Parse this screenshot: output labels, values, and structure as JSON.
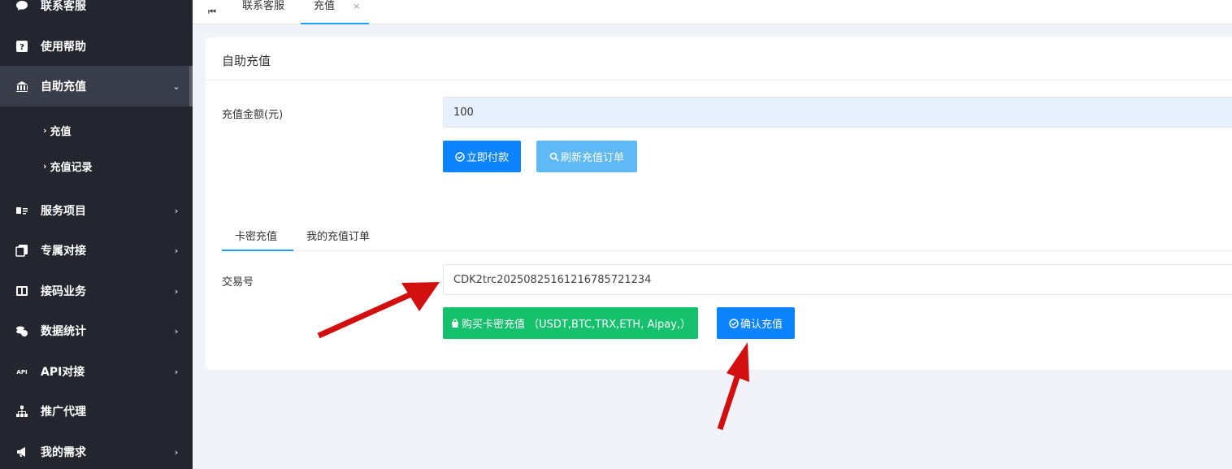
{
  "sidebar": {
    "items": [
      {
        "label": "联系客服",
        "icon": "chat-icon"
      },
      {
        "label": "使用帮助",
        "icon": "help-icon"
      },
      {
        "label": "自助充值",
        "icon": "bank-icon",
        "expanded": true
      },
      {
        "label": "服务项目",
        "icon": "card-icon"
      },
      {
        "label": "专属对接",
        "icon": "docs-icon"
      },
      {
        "label": "接码业务",
        "icon": "sim-icon"
      },
      {
        "label": "数据统计",
        "icon": "coins-icon"
      },
      {
        "label": "API对接",
        "icon": "api-icon"
      },
      {
        "label": "推广代理",
        "icon": "sitemap-icon"
      },
      {
        "label": "我的需求",
        "icon": "megaphone-icon"
      }
    ],
    "sub_items": [
      {
        "label": "充值"
      },
      {
        "label": "充值记录"
      }
    ]
  },
  "tabs": {
    "items": [
      {
        "label": "联系客服"
      },
      {
        "label": "充值",
        "active": true
      }
    ],
    "close_glyph": "×",
    "home_glyph": "⏮"
  },
  "card": {
    "title": "自助充值",
    "amount_label": "充值金额(元)",
    "amount_value": "100",
    "pay_button": "立即付款",
    "refresh_button": "刷新充值订单",
    "subtabs": [
      "卡密充值",
      "我的充值订单"
    ],
    "txn_label": "交易号",
    "txn_value": "CDK2trc20250825161216785721234",
    "buy_button": "购买卡密充值 （USDT,BTC,TRX,ETH, Aipay,）",
    "confirm_button": "确认充值"
  },
  "colors": {
    "sidebar_bg": "#23262e",
    "primary": "#0d84ff",
    "light_primary": "#5fb9f5",
    "success": "#16c16d",
    "annotation_arrow": "#d10f0f"
  }
}
